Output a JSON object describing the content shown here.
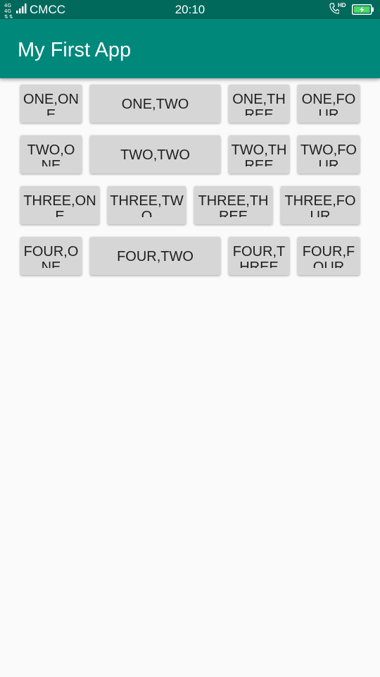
{
  "status_bar": {
    "network_type": "4G 4G",
    "carrier": "CMCC",
    "time": "20:10",
    "hd_label": "HD",
    "background_color": "#00695c"
  },
  "app_bar": {
    "title": "My First App",
    "background_color": "#00897b"
  },
  "grid": {
    "rows": [
      {
        "buttons": [
          "ONE,ONE",
          "ONE,TWO",
          "ONE,THREE",
          "ONE,FOUR"
        ]
      },
      {
        "buttons": [
          "TWO,ONE",
          "TWO,TWO",
          "TWO,THREE",
          "TWO,FOUR"
        ]
      },
      {
        "buttons": [
          "THREE,ONE",
          "THREE,TWO",
          "THREE,THREE",
          "THREE,FOUR"
        ]
      },
      {
        "buttons": [
          "FOUR,ONE",
          "FOUR,TWO",
          "FOUR,THREE",
          "FOUR,FOUR"
        ]
      }
    ]
  },
  "icons": [
    "signal-icon",
    "call-icon",
    "battery-charging-icon"
  ]
}
